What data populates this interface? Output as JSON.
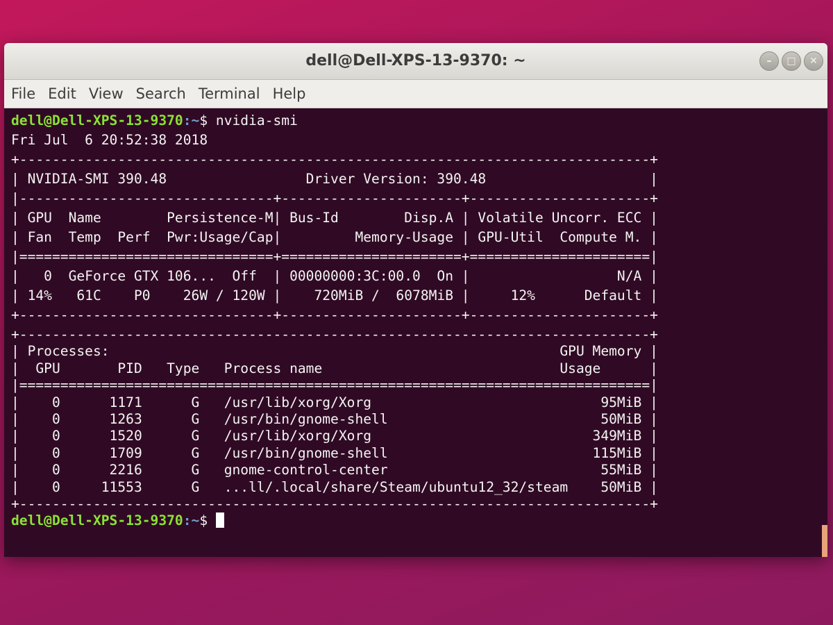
{
  "window": {
    "title": "dell@Dell-XPS-13-9370: ~",
    "controls": {
      "minimize_glyph": "–",
      "maximize_glyph": "□",
      "close_glyph": "✕"
    }
  },
  "menubar": {
    "items": [
      "File",
      "Edit",
      "View",
      "Search",
      "Terminal",
      "Help"
    ]
  },
  "terminal": {
    "prompt_user": "dell@Dell-XPS-13-9370",
    "prompt_path": ":~",
    "prompt_symbol": "$ ",
    "command": "nvidia-smi",
    "date_line": "Fri Jul  6 20:52:38 2018",
    "smi_lines": [
      "+-----------------------------------------------------------------------------+",
      "| NVIDIA-SMI 390.48                 Driver Version: 390.48                    |",
      "|-------------------------------+----------------------+----------------------+",
      "| GPU  Name        Persistence-M| Bus-Id        Disp.A | Volatile Uncorr. ECC |",
      "| Fan  Temp  Perf  Pwr:Usage/Cap|         Memory-Usage | GPU-Util  Compute M. |",
      "|===============================+======================+======================|",
      "|   0  GeForce GTX 106...  Off  | 00000000:3C:00.0  On |                  N/A |",
      "| 14%   61C    P0    26W / 120W |    720MiB /  6078MiB |     12%      Default |",
      "+-------------------------------+----------------------+----------------------+"
    ],
    "process_lines": [
      "+-----------------------------------------------------------------------------+",
      "| Processes:                                                       GPU Memory |",
      "|  GPU       PID   Type   Process name                             Usage      |",
      "|=============================================================================|",
      "|    0      1171      G   /usr/lib/xorg/Xorg                            95MiB |",
      "|    0      1263      G   /usr/bin/gnome-shell                          50MiB |",
      "|    0      1520      G   /usr/lib/xorg/Xorg                           349MiB |",
      "|    0      1709      G   /usr/bin/gnome-shell                         115MiB |",
      "|    0      2216      G   gnome-control-center                          55MiB |",
      "|    0     11553      G   ...ll/.local/share/Steam/ubuntu12_32/steam    50MiB |",
      "+-----------------------------------------------------------------------------+"
    ]
  },
  "colors": {
    "terminal_bg": "#300a24",
    "prompt_user": "#8ae234",
    "prompt_path": "#729fcf",
    "desktop": "#c2185b"
  }
}
